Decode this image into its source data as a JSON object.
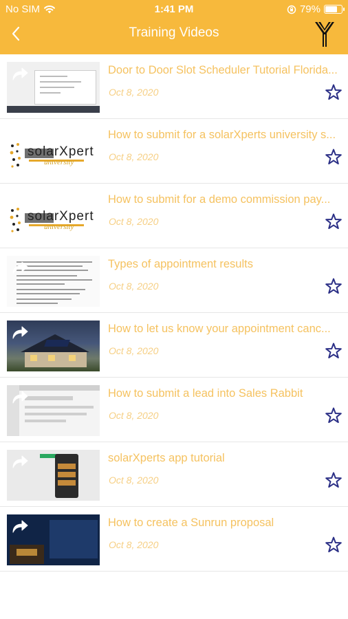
{
  "status_bar": {
    "carrier": "No SIM",
    "time": "1:41 PM",
    "battery_percent": "79%",
    "battery_level": 0.79,
    "icons": [
      "wifi-icon",
      "orientation-lock-icon",
      "battery-icon"
    ]
  },
  "nav": {
    "title": "Training Videos",
    "back_icon": "chevron-left-icon",
    "logo_icon": "solarxperts-logo-icon"
  },
  "colors": {
    "header_bg": "#f7b93c",
    "title_text": "#f5c260",
    "date_text": "#f6cf84",
    "star": "#2b2f86"
  },
  "videos": [
    {
      "title": "Door to Door Slot Scheduler Tutorial Florida...",
      "date": "Oct 8, 2020",
      "thumb": "doc",
      "favorite": false
    },
    {
      "title": "How to submit for a solarXperts university s...",
      "date": "Oct 8, 2020",
      "thumb": "brand",
      "favorite": false
    },
    {
      "title": "How to submit for a demo commission pay...",
      "date": "Oct 8, 2020",
      "thumb": "brand",
      "favorite": false
    },
    {
      "title": "Types of appointment results",
      "date": "Oct 8, 2020",
      "thumb": "text",
      "favorite": false
    },
    {
      "title": "How to let us know your appointment canc...",
      "date": "Oct 8, 2020",
      "thumb": "house",
      "favorite": false
    },
    {
      "title": "How to submit a lead into Sales Rabbit",
      "date": "Oct 8, 2020",
      "thumb": "screen",
      "favorite": false
    },
    {
      "title": "solarXperts app tutorial",
      "date": "Oct 8, 2020",
      "thumb": "app",
      "favorite": false
    },
    {
      "title": "How to create a Sunrun proposal",
      "date": "Oct 8, 2020",
      "thumb": "dark",
      "favorite": false
    }
  ],
  "thumb_brand_text": {
    "word": "solarXpert",
    "sub": "university"
  }
}
